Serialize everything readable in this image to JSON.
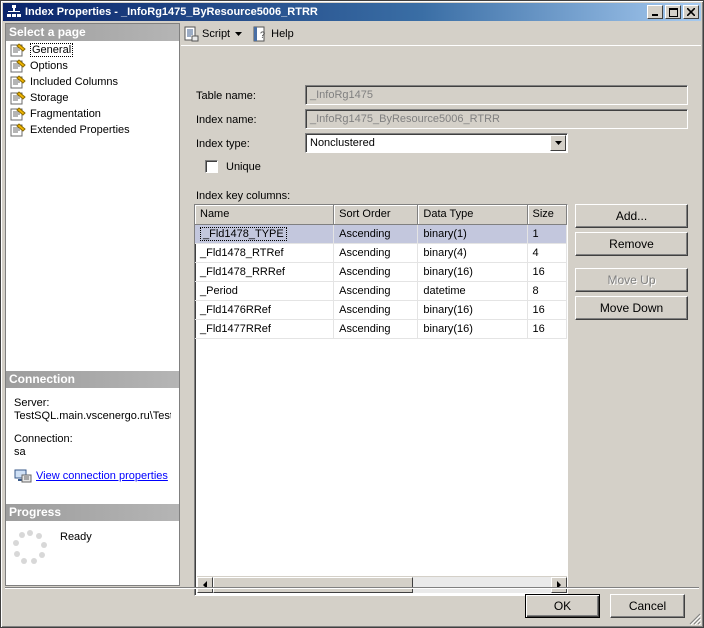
{
  "window": {
    "title": "Index Properties - _InfoRg1475_ByResource5006_RTRR"
  },
  "sidebar": {
    "select_page_header": "Select a page",
    "items": [
      {
        "label": "General",
        "icon": "page-icon",
        "selected": true
      },
      {
        "label": "Options",
        "icon": "page-icon"
      },
      {
        "label": "Included Columns",
        "icon": "page-icon"
      },
      {
        "label": "Storage",
        "icon": "page-icon"
      },
      {
        "label": "Fragmentation",
        "icon": "page-icon"
      },
      {
        "label": "Extended Properties",
        "icon": "page-icon"
      }
    ],
    "connection_header": "Connection",
    "server_label": "Server:",
    "server_value": "TestSQL.main.vscenergo.ru\\TestS",
    "connection_label": "Connection:",
    "connection_value": "sa",
    "view_connection_link": "View connection properties",
    "progress_header": "Progress",
    "progress_status": "Ready"
  },
  "toolbar": {
    "script_label": "Script",
    "help_label": "Help"
  },
  "form": {
    "table_name_label": "Table name:",
    "table_name_value": "_InfoRg1475",
    "index_name_label": "Index name:",
    "index_name_value": "_InfoRg1475_ByResource5006_RTRR",
    "index_type_label": "Index type:",
    "index_type_value": "Nonclustered",
    "unique_label": "Unique",
    "unique_checked": false,
    "key_columns_label": "Index key columns:"
  },
  "grid": {
    "columns": [
      "Name",
      "Sort Order",
      "Data Type",
      "Size"
    ],
    "rows": [
      [
        "_Fld1478_TYPE",
        "Ascending",
        "binary(1)",
        "1"
      ],
      [
        "_Fld1478_RTRef",
        "Ascending",
        "binary(4)",
        "4"
      ],
      [
        "_Fld1478_RRRef",
        "Ascending",
        "binary(16)",
        "16"
      ],
      [
        "_Period",
        "Ascending",
        "datetime",
        "8"
      ],
      [
        "_Fld1476RRef",
        "Ascending",
        "binary(16)",
        "16"
      ],
      [
        "_Fld1477RRef",
        "Ascending",
        "binary(16)",
        "16"
      ]
    ]
  },
  "buttons": {
    "add": "Add...",
    "remove": "Remove",
    "move_up": "Move Up",
    "move_down": "Move Down",
    "ok": "OK",
    "cancel": "Cancel"
  }
}
